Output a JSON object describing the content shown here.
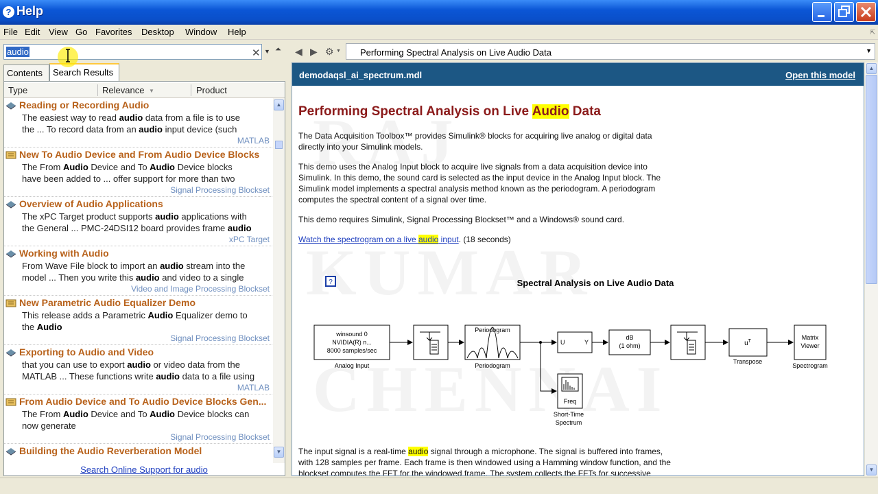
{
  "window": {
    "title": "Help"
  },
  "menu": [
    "File",
    "Edit",
    "View",
    "Go",
    "Favorites",
    "Desktop",
    "Window",
    "Help"
  ],
  "search": {
    "value": "audio"
  },
  "tabs": [
    "Contents",
    "Search Results"
  ],
  "columns": [
    "Type",
    "Relevance",
    "Product"
  ],
  "results": [
    {
      "title": "Reading or Recording Audio",
      "line1": "The easiest way to read audio data from a file is to use",
      "line2": "the ... To record data from an audio input device (such",
      "product": "MATLAB"
    },
    {
      "title": "New To Audio Device and From Audio Device Blocks",
      "line1": "The From Audio Device and To Audio Device blocks",
      "line2": "have been added to ... offer support for more than two",
      "product": "Signal Processing Blockset"
    },
    {
      "title": "Overview of Audio Applications",
      "line1": "The xPC Target product supports audio applications with",
      "line2": "the General ... PMC-24DSI12 board provides frame audio",
      "product": "xPC Target"
    },
    {
      "title": "Working with Audio",
      "line1": "From Wave File block to import an audio stream into the",
      "line2": "model ... Then you write this audio and video to a single",
      "product": "Video and Image Processing Blockset"
    },
    {
      "title": "New Parametric Audio Equalizer Demo",
      "line1": "This release adds a Parametric Audio Equalizer demo to",
      "line2": "the Audio",
      "product": "Signal Processing Blockset"
    },
    {
      "title": "Exporting to Audio and Video",
      "line1": "that you can use to export audio or video data from the",
      "line2": "MATLAB ... These functions write audio data to a file using",
      "product": "MATLAB"
    },
    {
      "title": "From Audio Device and To Audio Device Blocks Gen...",
      "line1": "The From Audio Device and To Audio Device blocks can",
      "line2": "now generate",
      "product": "Signal Processing Blockset"
    },
    {
      "title": "Building the Audio Reverberation Model",
      "line1": "",
      "line2": "",
      "product": ""
    }
  ],
  "online_link": "Search Online Support for audio",
  "nav": {
    "title": "Performing Spectral Analysis on Live Audio Data"
  },
  "doc": {
    "file": "demodaqsl_ai_spectrum.mdl",
    "open_link": "Open this model",
    "heading_pre": "Performing Spectral Analysis on Live ",
    "heading_hl": "Audio",
    "heading_post": " Data",
    "p1a": "The Data Acquisition Toolbox™ provides Simulink® blocks for acquiring live analog or digital data",
    "p1b": "directly into your Simulink models.",
    "p2a": "This demo uses the Analog Input block to acquire live signals from a data acquisition device into",
    "p2b": "Simulink. In this demo, the sound card is selected as the input device in the Analog Input block. The",
    "p2c": "Simulink model implements a spectral analysis method known as the periodogram. A periodogram",
    "p2d": "computes the spectral content of a signal over time.",
    "p3": "This demo requires Simulink, Signal Processing Blockset™ and a Windows® sound card.",
    "watch_pre": "Watch the spectrogram on a live ",
    "watch_hl": "audio",
    "watch_post": " input",
    "watch_tail": ". (18 seconds)",
    "p4a_pre": "The input signal is a real-time ",
    "p4a_hl": "audio",
    "p4a_post": " signal through a microphone. The signal is buffered into frames,",
    "p4b": "with 128 samples per frame. Each frame is then windowed using a Hamming window function, and the",
    "p4c": "blockset computes the FFT for the windowed frame. The system collects the FFTs for successive"
  },
  "diagram": {
    "title": "Spectral Analysis on Live Audio Data",
    "ai_l1": "winsound 0",
    "ai_l2": "NVIDIA(R) n...",
    "ai_l3": "8000 samples/sec",
    "ai_label": "Analog Input",
    "per_label": "Periodogram",
    "per_in": "Periodogram",
    "u_in": "U",
    "y_in": "Y",
    "db_l1": "dB",
    "db_l2": "(1 ohm)",
    "tr_label": "Transpose",
    "mv_l1": "Matrix",
    "mv_l2": "Viewer",
    "mv_label": "Spectrogram",
    "freq": "Freq",
    "st_l1": "Short-Time",
    "st_l2": "Spectrum"
  }
}
